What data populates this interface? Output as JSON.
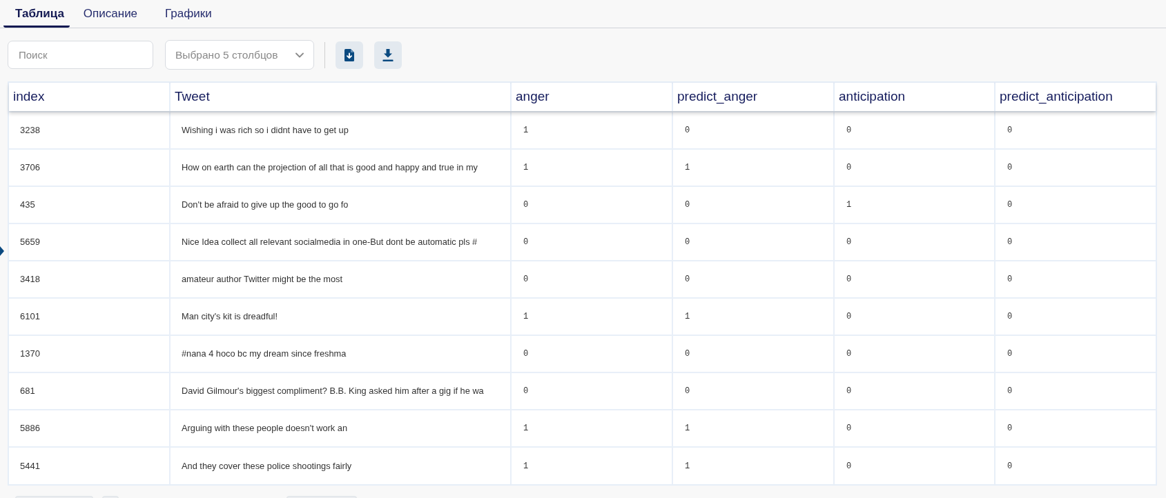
{
  "tabs": [
    {
      "label": "Таблица",
      "selected": true
    },
    {
      "label": "Описание",
      "selected": false
    },
    {
      "label": "Графики",
      "selected": false
    }
  ],
  "toolbar": {
    "search": {
      "placeholder": "Поиск"
    },
    "columns_select": {
      "value": "Выбрано 5 столбцов"
    }
  },
  "table": {
    "columns": [
      "index",
      "Tweet",
      "anger",
      "predict_anger",
      "anticipation",
      "predict_anticipation"
    ],
    "rows": [
      [
        "3238",
        "Wishing i was rich so i didnt have to get up",
        "1",
        "0",
        "0",
        "0"
      ],
      [
        "3706",
        "How on earth can the projection of all that is good and happy and true in my",
        "1",
        "1",
        "0",
        "0"
      ],
      [
        "435",
        "Don't be afraid to give up the good to go fo",
        "0",
        "0",
        "1",
        "0"
      ],
      [
        "5659",
        "Nice Idea collect all relevant socialmedia in one-But dont be automatic pls #",
        "0",
        "0",
        "0",
        "0"
      ],
      [
        "3418",
        "amateur author Twitter might be the most",
        "0",
        "0",
        "0",
        "0"
      ],
      [
        "6101",
        "Man city's kit is dreadful!",
        "1",
        "1",
        "0",
        "0"
      ],
      [
        "1370",
        "#nana 4 hoco bc my dream since freshma",
        "0",
        "0",
        "0",
        "0"
      ],
      [
        "681",
        "David Gilmour's biggest compliment? B.B. King asked him after a gig if he wa",
        "0",
        "0",
        "0",
        "0"
      ],
      [
        "5886",
        "Arguing with these people doesn't work an",
        "1",
        "1",
        "0",
        "0"
      ],
      [
        "5441",
        "And they cover these police shootings fairly",
        "1",
        "1",
        "0",
        "0"
      ]
    ]
  }
}
